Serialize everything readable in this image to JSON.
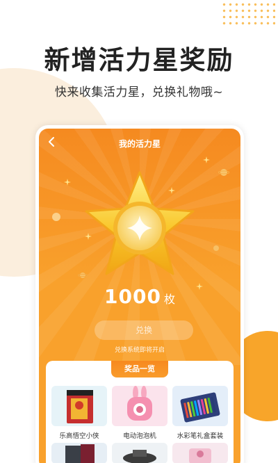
{
  "headline": "新增活力星奖励",
  "subline": "快来收集活力星，兑换礼物哦~",
  "screen": {
    "title": "我的活力星",
    "back_icon": "chevron-left-icon",
    "coin_count": "1000",
    "coin_unit": "枚",
    "redeem_label": "兑换",
    "redeem_note": "兑换系统即将开启",
    "prize_section_title": "奖品一览",
    "prizes": [
      {
        "name": "乐高悟空小侠"
      },
      {
        "name": "电动泡泡机"
      },
      {
        "name": "水彩笔礼盒套装"
      }
    ]
  },
  "colors": {
    "accent": "#f9a12c",
    "accent_dark": "#f58a20",
    "soft_bg": "#fbeedd"
  }
}
